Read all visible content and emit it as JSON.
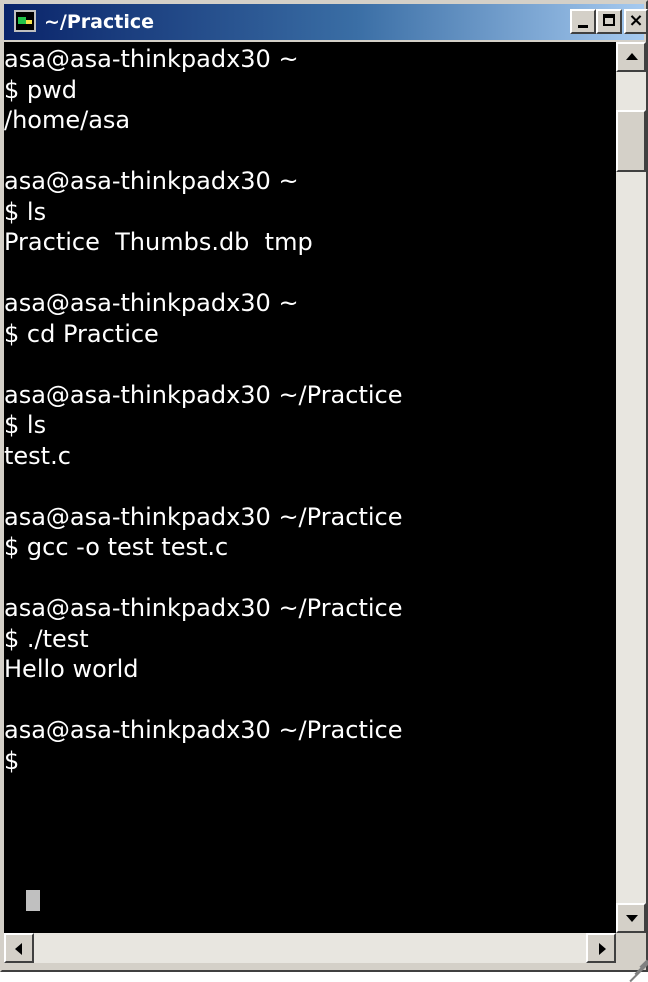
{
  "window": {
    "title": "~/Practice",
    "controls": {
      "minimize": "minimize",
      "maximize": "maximize",
      "close": "×"
    }
  },
  "terminal": {
    "lines": [
      "asa@asa-thinkpadx30 ~",
      "$ pwd",
      "/home/asa",
      "",
      "asa@asa-thinkpadx30 ~",
      "$ ls",
      "Practice  Thumbs.db  tmp",
      "",
      "asa@asa-thinkpadx30 ~",
      "$ cd Practice",
      "",
      "asa@asa-thinkpadx30 ~/Practice",
      "$ ls",
      "test.c",
      "",
      "asa@asa-thinkpadx30 ~/Practice",
      "$ gcc -o test test.c",
      "",
      "asa@asa-thinkpadx30 ~/Practice",
      "$ ./test",
      "Hello world",
      "",
      "asa@asa-thinkpadx30 ~/Practice",
      "$ "
    ],
    "background_color": "#000000",
    "text_color": "#ffffff",
    "cursor_color": "#c0c0c0"
  },
  "icons": {
    "app": "terminal-icon",
    "scroll_up": "arrow-up-icon",
    "scroll_down": "arrow-down-icon",
    "scroll_left": "arrow-left-icon",
    "scroll_right": "arrow-right-icon",
    "resize": "resize-grip-icon"
  }
}
